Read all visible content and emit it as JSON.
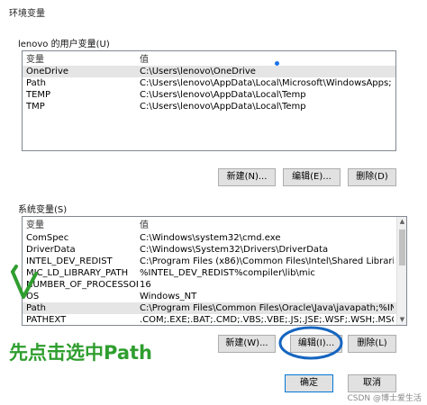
{
  "window": {
    "title": "环境变量"
  },
  "user_vars": {
    "group_label": "lenovo 的用户变量(U)",
    "headers": {
      "name": "变量",
      "value": "值"
    },
    "rows": [
      {
        "name": "OneDrive",
        "value": "C:\\Users\\lenovo\\OneDrive"
      },
      {
        "name": "Path",
        "value": "C:\\Users\\lenovo\\AppData\\Local\\Microsoft\\WindowsApps;"
      },
      {
        "name": "TEMP",
        "value": "C:\\Users\\lenovo\\AppData\\Local\\Temp"
      },
      {
        "name": "TMP",
        "value": "C:\\Users\\lenovo\\AppData\\Local\\Temp"
      }
    ],
    "buttons": {
      "new": "新建(N)...",
      "edit": "编辑(E)...",
      "delete": "删除(D)"
    }
  },
  "system_vars": {
    "group_label": "系统变量(S)",
    "headers": {
      "name": "变量",
      "value": "值"
    },
    "rows": [
      {
        "name": "ComSpec",
        "value": "C:\\Windows\\system32\\cmd.exe"
      },
      {
        "name": "DriverData",
        "value": "C:\\Windows\\System32\\Drivers\\DriverData"
      },
      {
        "name": "INTEL_DEV_REDIST",
        "value": "C:\\Program Files (x86)\\Common Files\\Intel\\Shared Libraries\\"
      },
      {
        "name": "MIC_LD_LIBRARY_PATH",
        "value": "%INTEL_DEV_REDIST%compiler\\lib\\mic"
      },
      {
        "name": "NUMBER_OF_PROCESSORS",
        "value": "16"
      },
      {
        "name": "OS",
        "value": "Windows_NT"
      },
      {
        "name": "Path",
        "value": "C:\\Program Files\\Common Files\\Oracle\\Java\\javapath;%INTEL_DEV..."
      },
      {
        "name": "PATHEXT",
        "value": ".COM;.EXE;.BAT;.CMD;.VBS;.VBE;.JS;.JSE;.WSF;.WSH;.MSC"
      }
    ],
    "buttons": {
      "new": "新建(W)...",
      "edit": "编辑(I)...",
      "delete": "删除(L)"
    }
  },
  "footer": {
    "ok": "确定",
    "cancel": "取消"
  },
  "annotation": {
    "text": "先点击选中Path",
    "color": "#2f9e2f",
    "circle_color": "#1565c0"
  },
  "watermark": "CSDN @博士爱生活"
}
